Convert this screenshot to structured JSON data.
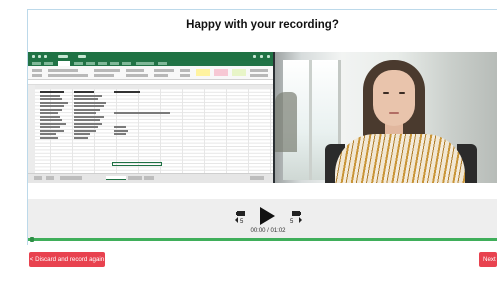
{
  "dialog": {
    "title": "Happy with your recording?"
  },
  "player": {
    "skip_back_label": "5",
    "skip_forward_label": "5",
    "time_display": "00:00 / 01:02",
    "progress": 0.0
  },
  "actions": {
    "discard_label": "< Discard and record again",
    "next_label": "Next"
  },
  "colors": {
    "accent_red": "#e8424f",
    "progress_green": "#3fae5a",
    "controls_bg": "#eeeeee",
    "excel_green": "#1f7244"
  },
  "icons": {
    "play": "play-icon",
    "skip_back": "rewind-5-icon",
    "skip_forward": "forward-5-icon"
  }
}
